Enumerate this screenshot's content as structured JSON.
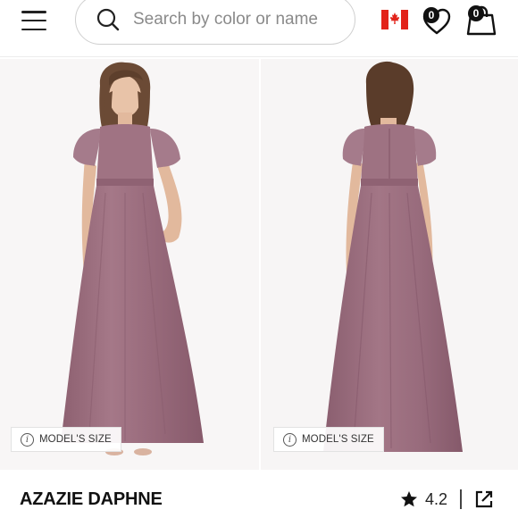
{
  "header": {
    "search_placeholder": "Search by color or name",
    "wishlist_count": "0",
    "cart_count": "0"
  },
  "gallery": {
    "front_model_size_label": "MODEL'S SIZE",
    "back_model_size_label": "MODEL'S SIZE"
  },
  "product": {
    "name": "AZAZIE DAPHNE",
    "rating": "4.2"
  },
  "colors": {
    "dress": "#9d6f80",
    "accent_red": "#e2231a"
  }
}
